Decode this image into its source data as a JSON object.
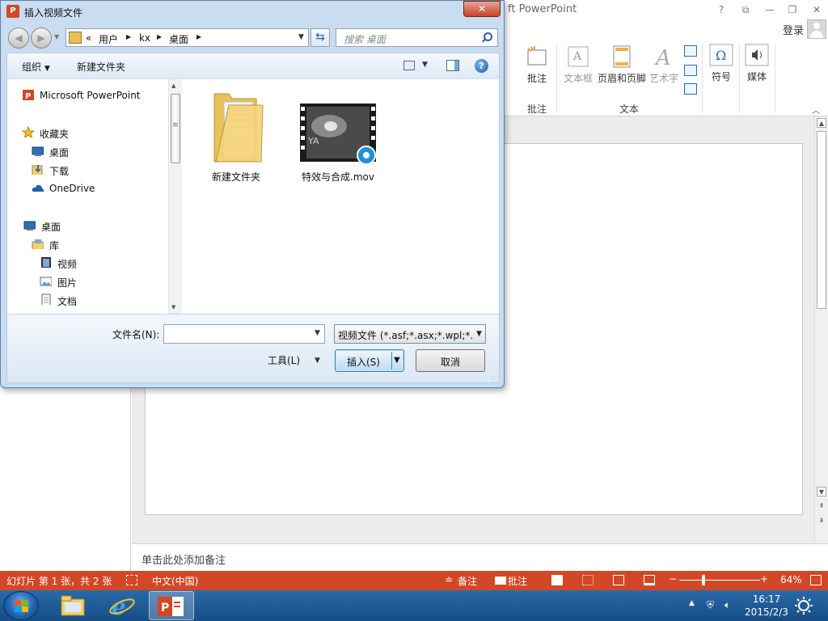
{
  "colors": {
    "ppt_accent": "#d24726",
    "taskbar": "#1f5a95",
    "dialog_frame": "#c9dcf0"
  },
  "powerpoint": {
    "title_fragment": "ft PowerPoint",
    "window_controls": [
      "?",
      "⧉",
      "—",
      "❐",
      "✕"
    ],
    "login": "登录",
    "ribbon": {
      "annotate_button": "批注",
      "annotate_group": "批注",
      "textbox_button": "文本框",
      "header_footer_button": "页眉和页脚",
      "wordart_button": "艺术字",
      "text_group": "文本",
      "symbol_button": "符号",
      "media_button": "媒体"
    },
    "notes_placeholder": "单击此处添加备注",
    "status": {
      "slide_info": "幻灯片 第 1 张，共 2 张",
      "language": "中文(中国)",
      "notes": "备注",
      "comments": "批注",
      "zoom": "64%"
    }
  },
  "taskbar": {
    "time": "16:17",
    "date": "2015/2/3"
  },
  "dialog": {
    "title": "插入视频文件",
    "close": "✕",
    "breadcrumb": [
      "«",
      "用户",
      "kx",
      "桌面"
    ],
    "search_placeholder": "搜索 桌面",
    "toolbar": {
      "organize": "组织",
      "new_folder": "新建文件夹"
    },
    "nav": [
      {
        "label": "Microsoft PowerPoint",
        "icon": "powerpoint-icon"
      },
      {
        "label": "收藏夹",
        "icon": "star-icon"
      },
      {
        "label": "桌面",
        "icon": "desktop-icon"
      },
      {
        "label": "下载",
        "icon": "download-icon"
      },
      {
        "label": "OneDrive",
        "icon": "cloud-icon"
      },
      {
        "label": "桌面",
        "icon": "desktop-icon"
      },
      {
        "label": "库",
        "icon": "library-icon"
      },
      {
        "label": "视频",
        "icon": "video-icon"
      },
      {
        "label": "图片",
        "icon": "picture-icon"
      },
      {
        "label": "文档",
        "icon": "document-icon"
      }
    ],
    "files": [
      {
        "name": "新建文件夹",
        "icon": "folder-icon"
      },
      {
        "name": "特效与合成.mov",
        "icon": "video-file-icon"
      }
    ],
    "filename_label": "文件名(N):",
    "filename_value": "",
    "filetype": "视频文件 (*.asf;*.asx;*.wpl;*.wm",
    "tools": "工具(L)",
    "insert": "插入(S)",
    "cancel": "取消"
  }
}
